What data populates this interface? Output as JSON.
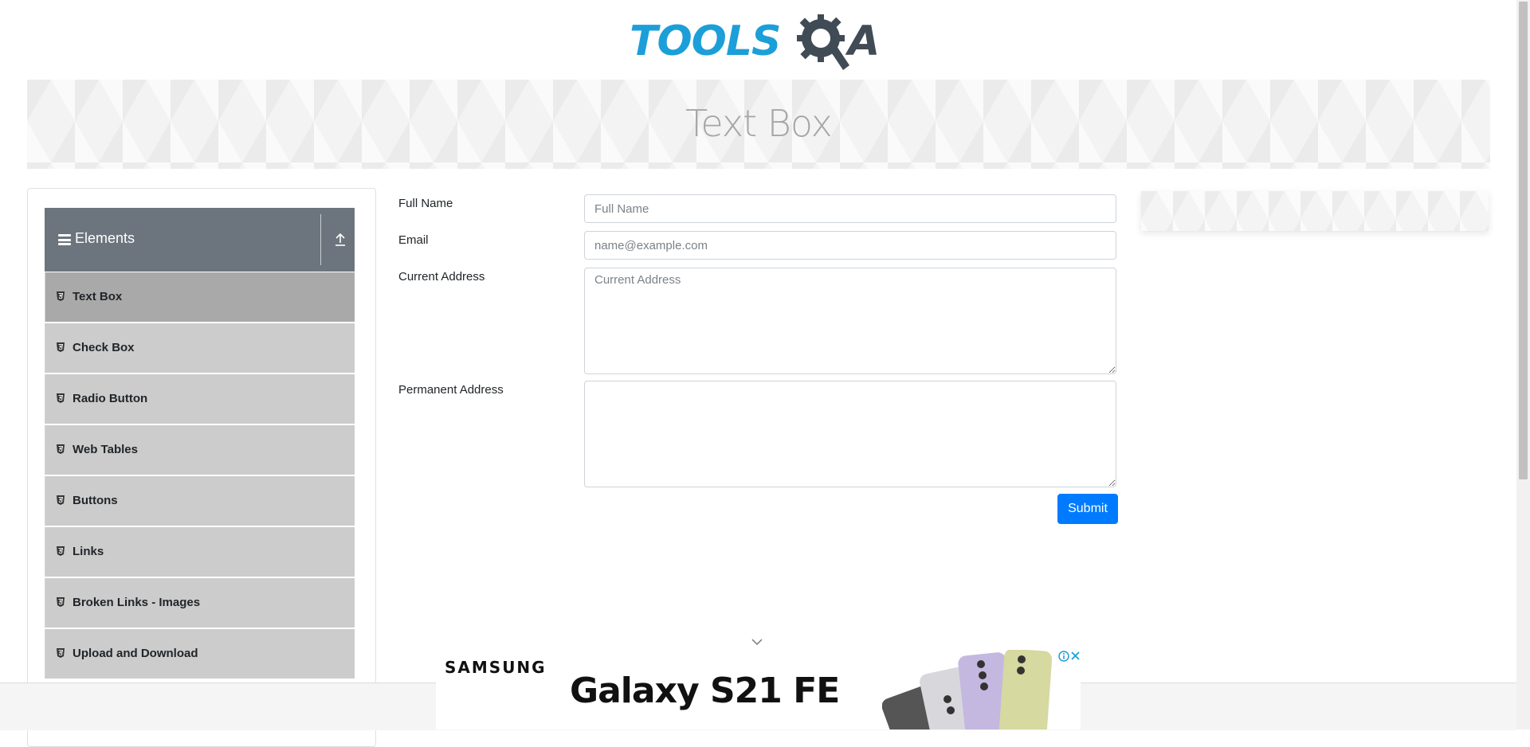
{
  "logo": {
    "part1": "TOOLS",
    "part2": "A",
    "alt": "TOOLSQA"
  },
  "banner": {
    "title": "Text Box"
  },
  "sidebar": {
    "group_title": "Elements",
    "items": [
      {
        "label": "Text Box",
        "active": true
      },
      {
        "label": "Check Box",
        "active": false
      },
      {
        "label": "Radio Button",
        "active": false
      },
      {
        "label": "Web Tables",
        "active": false
      },
      {
        "label": "Buttons",
        "active": false
      },
      {
        "label": "Links",
        "active": false
      },
      {
        "label": "Broken Links - Images",
        "active": false
      },
      {
        "label": "Upload and Download",
        "active": false
      }
    ]
  },
  "form": {
    "full_name": {
      "label": "Full Name",
      "placeholder": "Full Name",
      "value": ""
    },
    "email": {
      "label": "Email",
      "placeholder": "name@example.com",
      "value": ""
    },
    "current_address": {
      "label": "Current Address",
      "placeholder": "Current Address",
      "value": ""
    },
    "permanent_address": {
      "label": "Permanent Address",
      "placeholder": "",
      "value": ""
    },
    "submit_label": "Submit"
  },
  "ad": {
    "brand": "SAMSUNG",
    "product": "Galaxy S21 FE"
  },
  "colors": {
    "primary": "#007bff",
    "sidebar_header": "#6c757d",
    "sidebar_item": "#cccccc",
    "sidebar_item_active": "#a9a9a9",
    "logo_blue": "#1c9fd8",
    "logo_dark": "#414b55"
  }
}
